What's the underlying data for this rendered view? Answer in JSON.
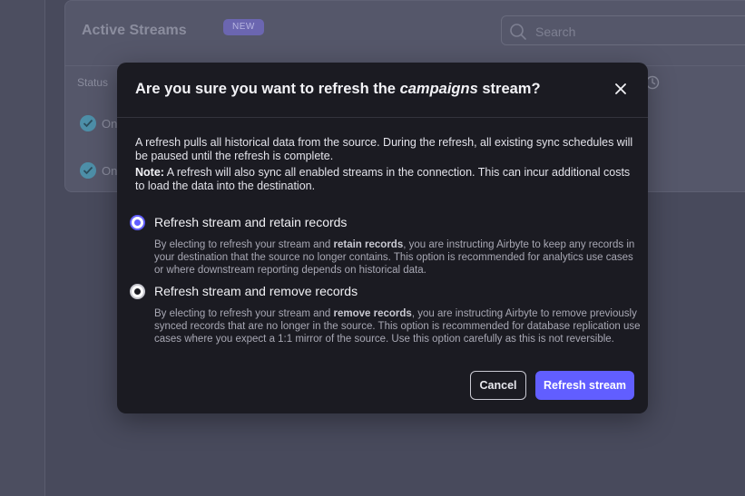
{
  "background": {
    "title": "Active Streams",
    "badge": "NEW",
    "search_placeholder": "Search",
    "status_header": "Status",
    "rows": [
      {
        "status_text": "On"
      },
      {
        "status_text": "On"
      }
    ]
  },
  "modal": {
    "title_prefix": "Are you sure you want to refresh the ",
    "title_stream": "campaigns",
    "title_suffix": " stream?",
    "intro": "A refresh pulls all historical data from the source. During the refresh, all existing sync schedules will be paused until the refresh is complete.",
    "note_label": "Note:",
    "note_text": " A refresh will also sync all enabled streams in the connection. This can incur additional costs to load the data into the destination.",
    "options": [
      {
        "label": "Refresh stream and retain records",
        "selected": true,
        "desc_before": "By electing to refresh your stream and ",
        "desc_bold": "retain records",
        "desc_after": ", you are instructing Airbyte to keep any records in your destination that the source no longer contains. This option is recommended for analytics use cases or where downstream reporting depends on historical data."
      },
      {
        "label": "Refresh stream and remove records",
        "selected": false,
        "desc_before": "By electing to refresh your stream and ",
        "desc_bold": "remove records",
        "desc_after": ", you are instructing Airbyte to remove previously synced records that are no longer in the source. This option is recommended for database replication use cases where you expect a 1:1 mirror of the source. Use this option carefully as this is not reversible."
      }
    ],
    "cancel_label": "Cancel",
    "confirm_label": "Refresh stream"
  },
  "colors": {
    "accent": "#615eff",
    "modal_bg": "#1b1b22",
    "overlay_bg": "#484a5c"
  },
  "icons": [
    "search-icon",
    "clock-icon",
    "check-circle-icon",
    "close-icon"
  ]
}
